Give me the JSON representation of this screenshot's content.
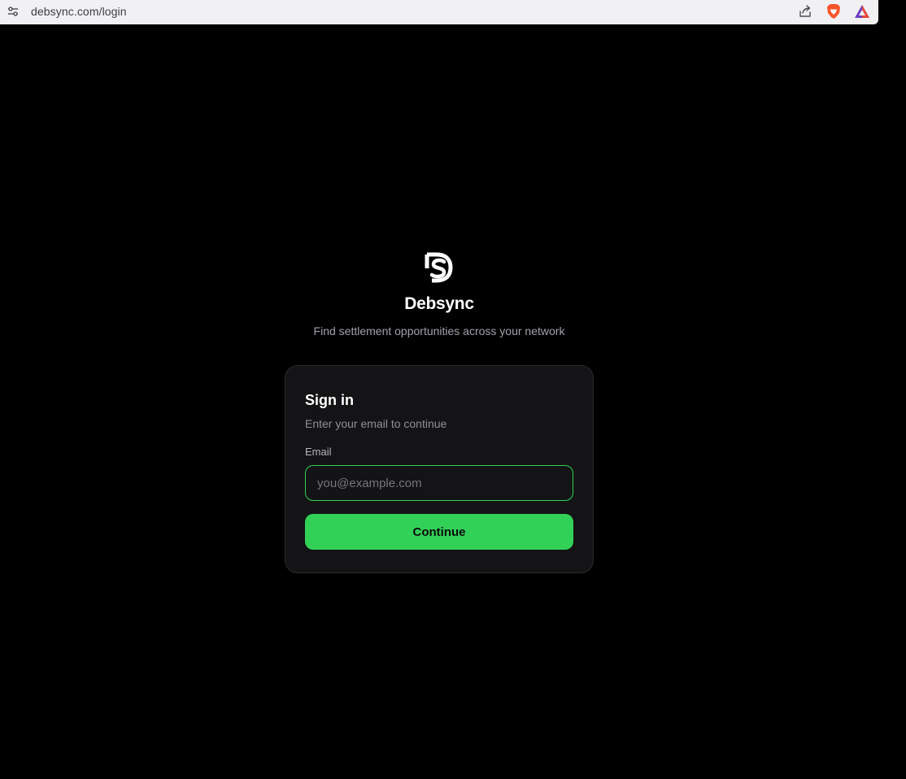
{
  "browser": {
    "url": "debsync.com/login",
    "icons": {
      "site_info": "site-settings-icon",
      "share": "share-icon",
      "brave": "brave-lion-icon",
      "rewards": "brave-rewards-icon"
    }
  },
  "brand": {
    "logo": "ds-logo-icon",
    "name": "Debsync",
    "tagline": "Find settlement opportunities across your network"
  },
  "signin": {
    "title": "Sign in",
    "subtitle": "Enter your email to continue",
    "email_label": "Email",
    "email_placeholder": "you@example.com",
    "email_value": "",
    "continue_label": "Continue"
  },
  "colors": {
    "accent": "#31d158",
    "background": "#000000",
    "card": "#141416",
    "browser_bar": "#f1f1f4"
  }
}
